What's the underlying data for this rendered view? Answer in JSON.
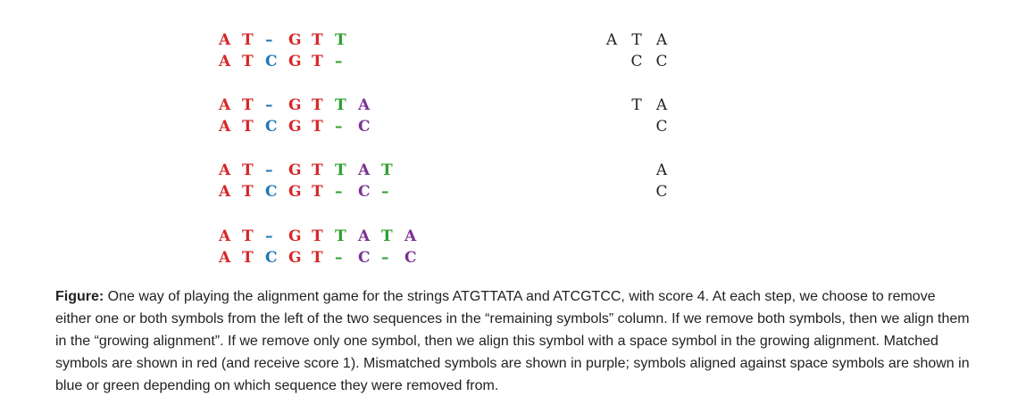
{
  "figure": {
    "alignments": [
      {
        "top": [
          [
            "A",
            "match"
          ],
          [
            "T",
            "match"
          ],
          [
            "–",
            "bottom"
          ],
          [
            "G",
            "match"
          ],
          [
            "T",
            "match"
          ],
          [
            "T",
            "top"
          ]
        ],
        "bottom": [
          [
            "A",
            "match"
          ],
          [
            "T",
            "match"
          ],
          [
            "C",
            "bottom"
          ],
          [
            "G",
            "match"
          ],
          [
            "T",
            "match"
          ],
          [
            "–",
            "top"
          ]
        ],
        "remaining": {
          "top": [
            "A",
            "T",
            "A"
          ],
          "bottom": [
            "",
            "C",
            "C"
          ]
        }
      },
      {
        "top": [
          [
            "A",
            "match"
          ],
          [
            "T",
            "match"
          ],
          [
            "–",
            "bottom"
          ],
          [
            "G",
            "match"
          ],
          [
            "T",
            "match"
          ],
          [
            "T",
            "top"
          ],
          [
            "A",
            "mismatch"
          ]
        ],
        "bottom": [
          [
            "A",
            "match"
          ],
          [
            "T",
            "match"
          ],
          [
            "C",
            "bottom"
          ],
          [
            "G",
            "match"
          ],
          [
            "T",
            "match"
          ],
          [
            "–",
            "top"
          ],
          [
            "C",
            "mismatch"
          ]
        ],
        "remaining": {
          "top": [
            "T",
            "A"
          ],
          "bottom": [
            "",
            "C"
          ]
        }
      },
      {
        "top": [
          [
            "A",
            "match"
          ],
          [
            "T",
            "match"
          ],
          [
            "–",
            "bottom"
          ],
          [
            "G",
            "match"
          ],
          [
            "T",
            "match"
          ],
          [
            "T",
            "top"
          ],
          [
            "A",
            "mismatch"
          ],
          [
            "T",
            "top"
          ]
        ],
        "bottom": [
          [
            "A",
            "match"
          ],
          [
            "T",
            "match"
          ],
          [
            "C",
            "bottom"
          ],
          [
            "G",
            "match"
          ],
          [
            "T",
            "match"
          ],
          [
            "–",
            "top"
          ],
          [
            "C",
            "mismatch"
          ],
          [
            "–",
            "top"
          ]
        ],
        "remaining": {
          "top": [
            "A"
          ],
          "bottom": [
            "C"
          ]
        }
      },
      {
        "top": [
          [
            "A",
            "match"
          ],
          [
            "T",
            "match"
          ],
          [
            "–",
            "bottom"
          ],
          [
            "G",
            "match"
          ],
          [
            "T",
            "match"
          ],
          [
            "T",
            "top"
          ],
          [
            "A",
            "mismatch"
          ],
          [
            "T",
            "top"
          ],
          [
            "A",
            "mismatch"
          ]
        ],
        "bottom": [
          [
            "A",
            "match"
          ],
          [
            "T",
            "match"
          ],
          [
            "C",
            "bottom"
          ],
          [
            "G",
            "match"
          ],
          [
            "T",
            "match"
          ],
          [
            "–",
            "top"
          ],
          [
            "C",
            "mismatch"
          ],
          [
            "–",
            "top"
          ],
          [
            "C",
            "mismatch"
          ]
        ],
        "remaining": {
          "top": [],
          "bottom": []
        }
      }
    ],
    "colors": {
      "match": "#d62728",
      "top": "#2ca02c",
      "bottom": "#1f77b4",
      "mismatch": "#7b3294"
    }
  },
  "caption": {
    "label": "Figure:",
    "text": " One way of playing the alignment game for the strings ATGTTATA and ATCGTCC, with score 4. At each step, we choose to remove either one or both symbols from the left of the two sequences in the “remaining symbols” column. If we remove both symbols, then we align them in the “growing alignment”. If we remove only one symbol, then we align this symbol with a space symbol in the growing alignment. Matched symbols are shown in red (and receive score 1). Mismatched symbols are shown in purple; symbols aligned against space symbols are shown in blue or green depending on which sequence they were removed from."
  }
}
